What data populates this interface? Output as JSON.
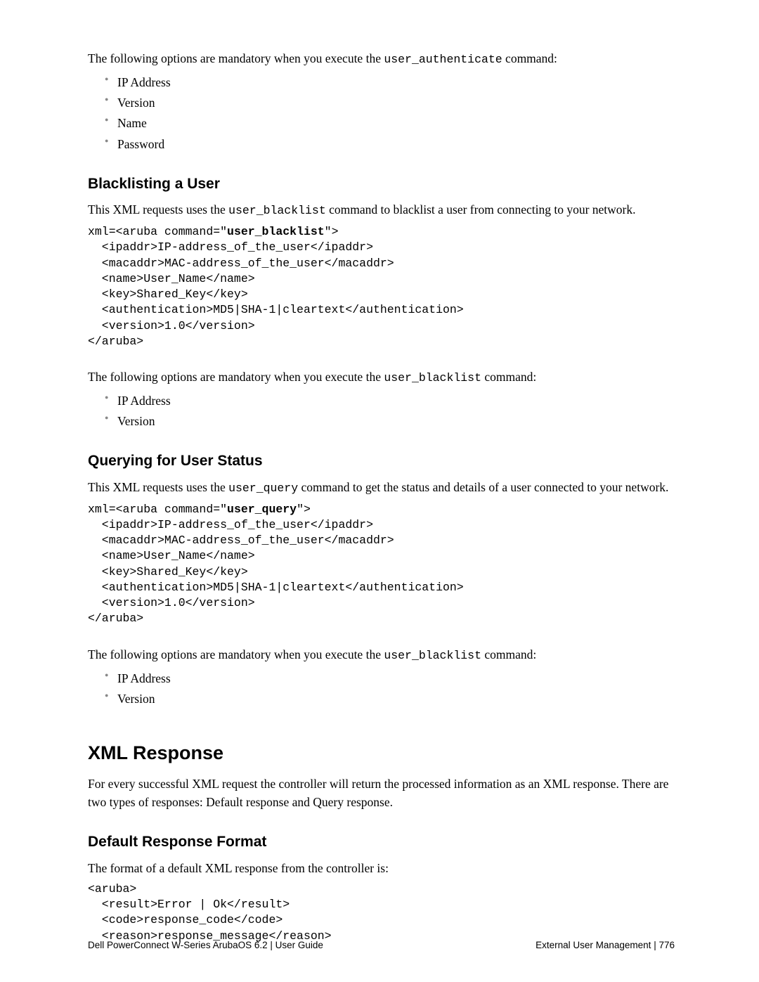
{
  "intro": {
    "text_before": "The following options are mandatory when you execute the ",
    "code": "user_authenticate",
    "text_after": " command:",
    "items": [
      "IP Address",
      "Version",
      "Name",
      "Password"
    ]
  },
  "section1": {
    "heading": "Blacklisting a User",
    "para_before": "This XML requests uses the ",
    "para_code": "user_blacklist",
    "para_after": " command to blacklist a user from connecting to your network.",
    "code_p1": "xml=<aruba command=\"",
    "code_bold": "user_blacklist",
    "code_p2": "\">\n  <ipaddr>IP-address_of_the_user</ipaddr>\n  <macaddr>MAC-address_of_the_user</macaddr>\n  <name>User_Name</name>\n  <key>Shared_Key</key>\n  <authentication>MD5|SHA-1|cleartext</authentication>\n  <version>1.0</version>\n</aruba>",
    "mand_before": "The following options are mandatory when you execute the ",
    "mand_code": "user_blacklist",
    "mand_after": " command:",
    "items": [
      "IP Address",
      "Version"
    ]
  },
  "section2": {
    "heading": "Querying for User Status",
    "para_before": "This XML requests uses the ",
    "para_code": "user_query",
    "para_after": " command to get the status and details of a user connected to your network.",
    "code_p1": "xml=<aruba command=\"",
    "code_bold": "user_query",
    "code_p2": "\">\n  <ipaddr>IP-address_of_the_user</ipaddr>\n  <macaddr>MAC-address_of_the_user</macaddr>\n  <name>User_Name</name>\n  <key>Shared_Key</key>\n  <authentication>MD5|SHA-1|cleartext</authentication>\n  <version>1.0</version>\n</aruba>",
    "mand_before": "The following options are mandatory when you execute the ",
    "mand_code": "user_blacklist",
    "mand_after": " command:",
    "items": [
      "IP Address",
      "Version"
    ]
  },
  "section3": {
    "heading": "XML Response",
    "para": "For every successful XML request the controller will return the processed information as an XML response. There are two types of responses: Default response and Query response."
  },
  "section4": {
    "heading": "Default Response Format",
    "para": "The format of a default XML response from the controller is:",
    "code": "<aruba>\n  <result>Error | Ok</result>\n  <code>response_code</code>\n  <reason>response_message</reason>"
  },
  "footer": {
    "left": "Dell PowerConnect W-Series ArubaOS 6.2",
    "left2": "User Guide",
    "right": "External User Management",
    "page": "776"
  }
}
